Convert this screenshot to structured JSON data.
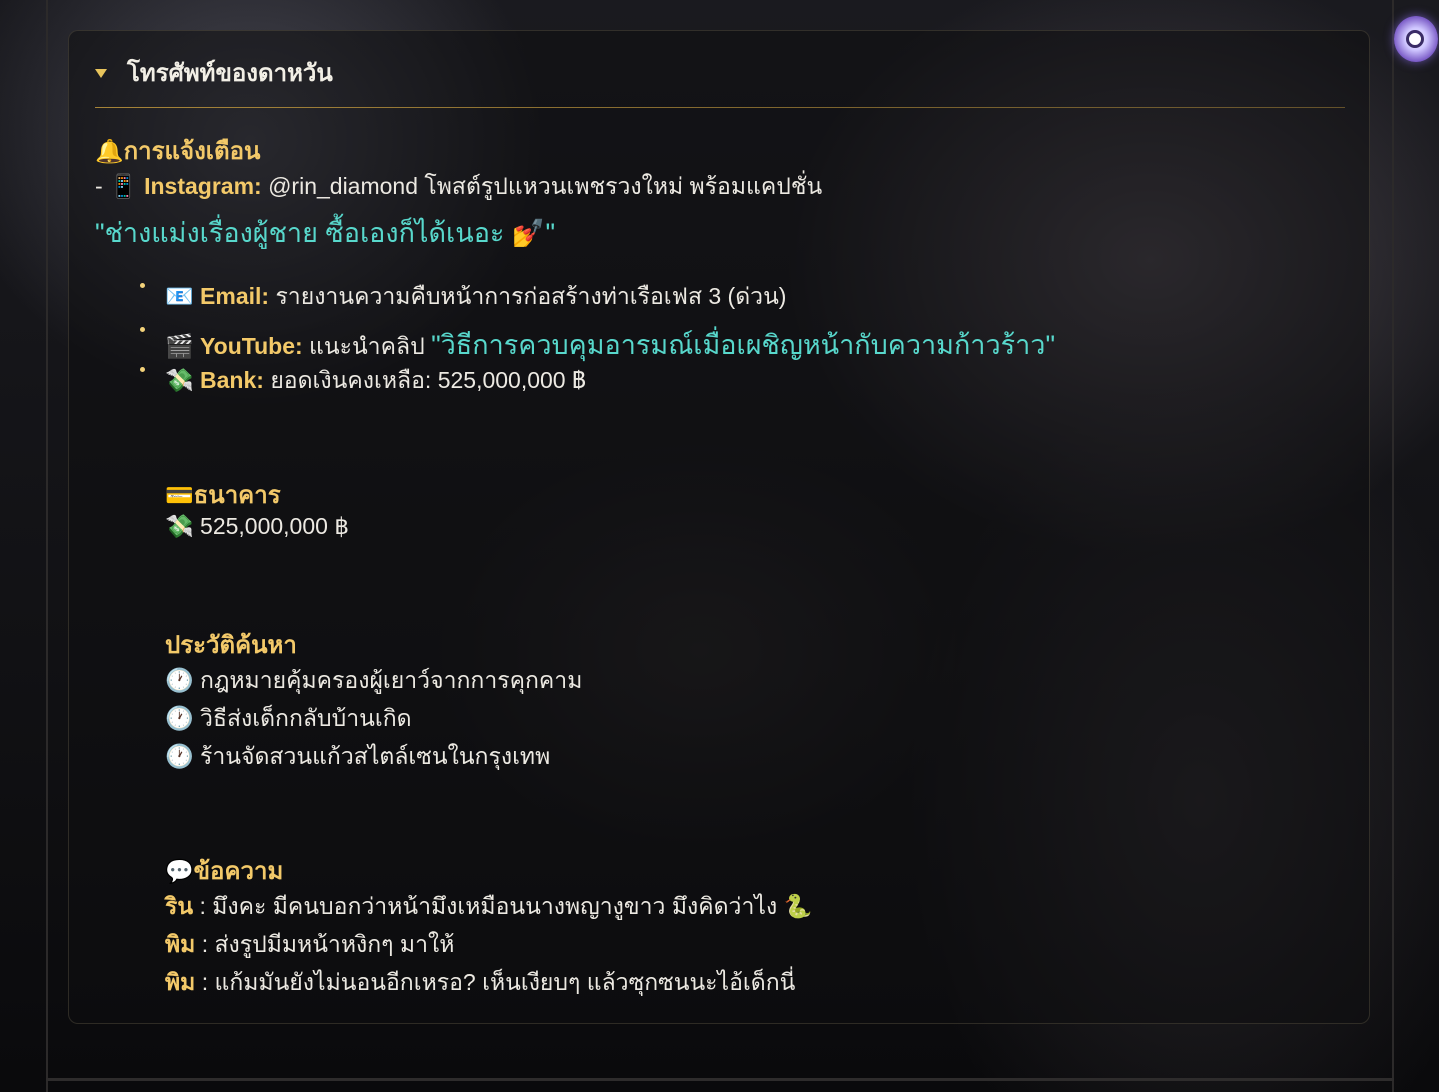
{
  "panel": {
    "title": "โทรศัพท์ของดาหวัน"
  },
  "notifications": {
    "heading": "การแจ้งเตือน",
    "heading_icon": "bell-icon",
    "instagram": {
      "prefix": "-",
      "icon": "mobile-phone-icon",
      "label": "Instagram:",
      "text": "@rin_diamond โพสต์รูปแหวนเพชรวงใหม่ พร้อมแคปชั่น",
      "caption": "\"ช่างแม่งเรื่องผู้ชาย ซื้อเองก็ได้เนอะ 💅\""
    },
    "items": [
      {
        "icon": "📧",
        "icon_name": "email-icon",
        "label": "Email:",
        "text": "รายงานความคืบหน้าการก่อสร้างท่าเรือเฟส 3 (ด่วน)",
        "highlight": ""
      },
      {
        "icon": "🎬",
        "icon_name": "clapperboard-icon",
        "label": "YouTube:",
        "text": "แนะนำคลิป",
        "highlight": "\"วิธีการควบคุมอารมณ์เมื่อเผชิญหน้ากับความก้าวร้าว\""
      },
      {
        "icon": "💸",
        "icon_name": "money-wings-icon",
        "label": "Bank:",
        "text": "ยอดเงินคงเหลือ: 525,000,000 ฿",
        "highlight": ""
      }
    ]
  },
  "bank": {
    "heading": "ธนาคาร",
    "heading_icon": "credit-card-icon",
    "balance_icon": "money-wings-icon",
    "balance": "525,000,000 ฿"
  },
  "history": {
    "heading": "ประวัติค้นหา",
    "item_icon": "clock-icon",
    "items": [
      "กฎหมายคุ้มครองผู้เยาว์จากการคุกคาม",
      "วิธีส่งเด็กกลับบ้านเกิด",
      "ร้านจัดสวนแก้วสไตล์เซนในกรุงเทพ"
    ]
  },
  "messages": {
    "heading": "ข้อความ",
    "heading_icon": "speech-bubble-icon",
    "items": [
      {
        "sender": "ริน",
        "separator": " : ",
        "text": "มึงคะ มีคนบอกว่าหน้ามึงเหมือนนางพญางูขาว มึงคิดว่าไง 🐍"
      },
      {
        "sender": "พิม",
        "separator": " : ",
        "text": "ส่งรูปมีมหน้าหงิกๆ มาให้"
      },
      {
        "sender": "พิม",
        "separator": " : ",
        "text": "แก้มมันยังไม่นอนอีกเหรอ? เห็นเงียบๆ แล้วซุกซนนะไอ้เด็กนี่"
      }
    ]
  },
  "colors": {
    "accent_gold": "#f3c969",
    "quote_teal": "#58d8cc",
    "text": "#ece9e2"
  }
}
